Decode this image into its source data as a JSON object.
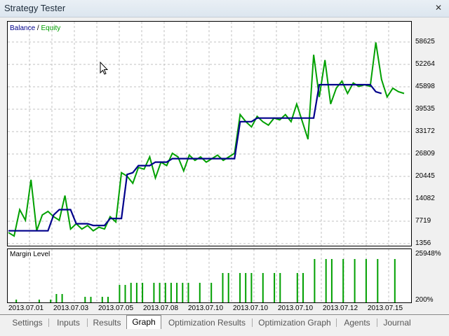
{
  "window": {
    "title": "Strategy Tester",
    "close_label": "✕"
  },
  "chart_data": [
    {
      "type": "line",
      "title": "Balance / Equity",
      "legend": [
        "Balance",
        "Equity"
      ],
      "y_ticks": [
        "58625",
        "52264",
        "45898",
        "39535",
        "33172",
        "26809",
        "20445",
        "14082",
        "7719",
        "1356"
      ],
      "x_ticks": [
        "2013.07.01",
        "2013.07.03",
        "2013.07.05",
        "2013.07.08",
        "2013.07.10",
        "2013.07.10",
        "2013.07.10",
        "2013.07.12",
        "2013.07.15"
      ],
      "ylim": [
        1356,
        58625
      ],
      "n_points": 61,
      "series": [
        {
          "name": "Balance",
          "color": "#00008b",
          "values": [
            [
              0,
              5000
            ],
            [
              7,
              5000
            ],
            [
              8,
              9500
            ],
            [
              9,
              11000
            ],
            [
              11,
              11000
            ],
            [
              12,
              7000
            ],
            [
              14,
              7000
            ],
            [
              15,
              6500
            ],
            [
              17,
              6500
            ],
            [
              18,
              8500
            ],
            [
              20,
              8500
            ],
            [
              21,
              21000
            ],
            [
              22,
              21500
            ],
            [
              23,
              23500
            ],
            [
              25,
              23500
            ],
            [
              26,
              24500
            ],
            [
              28,
              24500
            ],
            [
              29,
              25500
            ],
            [
              40,
              25500
            ],
            [
              41,
              36000
            ],
            [
              43,
              36000
            ],
            [
              44,
              37000
            ],
            [
              54,
              37000
            ],
            [
              55,
              46500
            ],
            [
              64,
              46500
            ],
            [
              65,
              44500
            ],
            [
              66,
              44000
            ]
          ]
        },
        {
          "name": "Equity",
          "color": "#00a000",
          "values": [
            [
              0,
              4500
            ],
            [
              1,
              3500
            ],
            [
              2,
              11000
            ],
            [
              3,
              8000
            ],
            [
              4,
              19500
            ],
            [
              5,
              5000
            ],
            [
              6,
              9500
            ],
            [
              7,
              10500
            ],
            [
              8,
              9000
            ],
            [
              9,
              8000
            ],
            [
              10,
              15000
            ],
            [
              11,
              5500
            ],
            [
              12,
              7000
            ],
            [
              13,
              5500
            ],
            [
              14,
              6500
            ],
            [
              15,
              5000
            ],
            [
              16,
              6000
            ],
            [
              17,
              5500
            ],
            [
              18,
              9000
            ],
            [
              19,
              7500
            ],
            [
              20,
              21500
            ],
            [
              21,
              20500
            ],
            [
              22,
              18500
            ],
            [
              23,
              23000
            ],
            [
              24,
              22500
            ],
            [
              25,
              26000
            ],
            [
              26,
              20000
            ],
            [
              27,
              24500
            ],
            [
              28,
              23500
            ],
            [
              29,
              27000
            ],
            [
              30,
              26000
            ],
            [
              31,
              22000
            ],
            [
              32,
              26500
            ],
            [
              33,
              25000
            ],
            [
              34,
              26000
            ],
            [
              35,
              24500
            ],
            [
              36,
              25500
            ],
            [
              37,
              26500
            ],
            [
              38,
              25000
            ],
            [
              39,
              26000
            ],
            [
              40,
              27000
            ],
            [
              41,
              38000
            ],
            [
              42,
              36000
            ],
            [
              43,
              34500
            ],
            [
              44,
              37500
            ],
            [
              45,
              36000
            ],
            [
              46,
              35000
            ],
            [
              47,
              37000
            ],
            [
              48,
              36500
            ],
            [
              49,
              38000
            ],
            [
              50,
              36000
            ],
            [
              51,
              41000
            ],
            [
              52,
              36000
            ],
            [
              53,
              31000
            ],
            [
              54,
              55000
            ],
            [
              55,
              43000
            ],
            [
              56,
              53500
            ],
            [
              57,
              41000
            ],
            [
              58,
              45500
            ],
            [
              59,
              47500
            ],
            [
              60,
              44000
            ],
            [
              61,
              47000
            ],
            [
              62,
              46000
            ],
            [
              63,
              46500
            ],
            [
              64,
              46000
            ],
            [
              65,
              58500
            ],
            [
              66,
              48000
            ],
            [
              67,
              43000
            ],
            [
              68,
              45500
            ],
            [
              69,
              44500
            ],
            [
              70,
              44000
            ]
          ]
        }
      ]
    },
    {
      "type": "bar",
      "title": "Margin Level",
      "y_ticks": [
        "25948%",
        "200%"
      ],
      "values": [
        0,
        4,
        0,
        0,
        0,
        4,
        0,
        4,
        12,
        12,
        0,
        0,
        0,
        8,
        8,
        0,
        8,
        8,
        0,
        25,
        25,
        28,
        28,
        28,
        0,
        28,
        28,
        28,
        28,
        28,
        28,
        28,
        0,
        28,
        0,
        28,
        0,
        42,
        42,
        0,
        42,
        42,
        42,
        0,
        42,
        0,
        42,
        42,
        0,
        0,
        42,
        42,
        0,
        62,
        0,
        62,
        62,
        0,
        62,
        0,
        62,
        0,
        62,
        0,
        62,
        0,
        0,
        62,
        0
      ]
    }
  ],
  "tabs": [
    {
      "label": "Settings",
      "active": false
    },
    {
      "label": "Inputs",
      "active": false
    },
    {
      "label": "Results",
      "active": false
    },
    {
      "label": "Graph",
      "active": true
    },
    {
      "label": "Optimization Results",
      "active": false
    },
    {
      "label": "Optimization Graph",
      "active": false
    },
    {
      "label": "Agents",
      "active": false
    },
    {
      "label": "Journal",
      "active": false
    }
  ]
}
